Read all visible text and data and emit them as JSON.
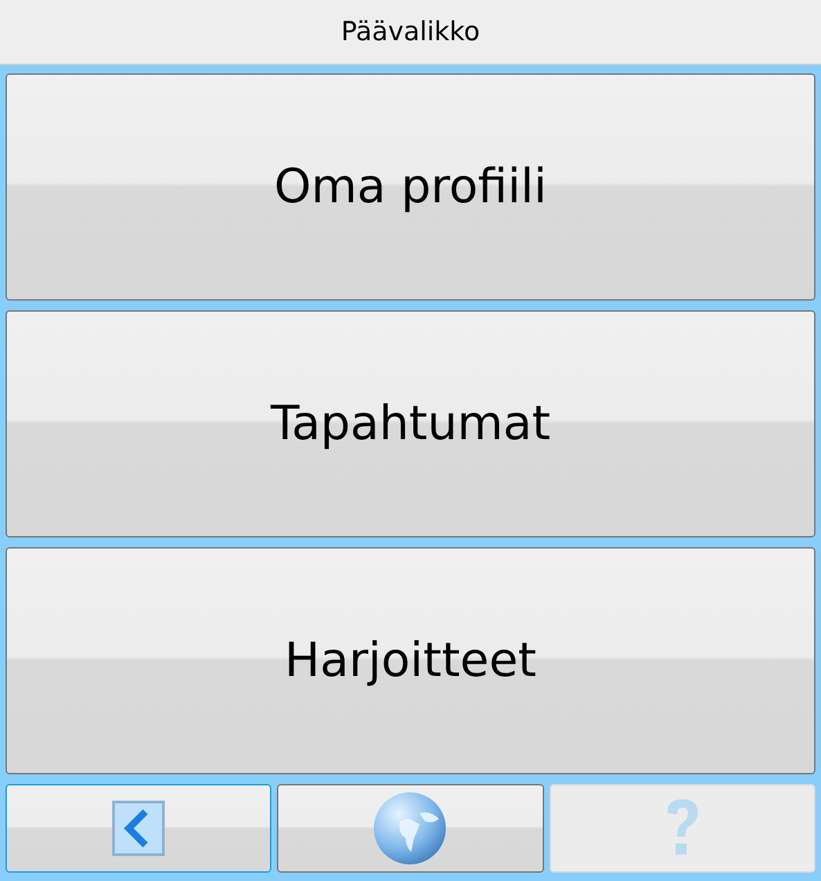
{
  "window": {
    "title": "Päävalikko"
  },
  "menu_buttons": [
    {
      "label": "Oma profiili"
    },
    {
      "label": "Tapahtumat"
    },
    {
      "label": "Harjoitteet"
    }
  ],
  "toolbar_buttons": [
    {
      "kind": "back",
      "focused": true,
      "disabled": false
    },
    {
      "kind": "globe",
      "focused": false,
      "disabled": false
    },
    {
      "kind": "help",
      "focused": false,
      "disabled": true
    }
  ]
}
